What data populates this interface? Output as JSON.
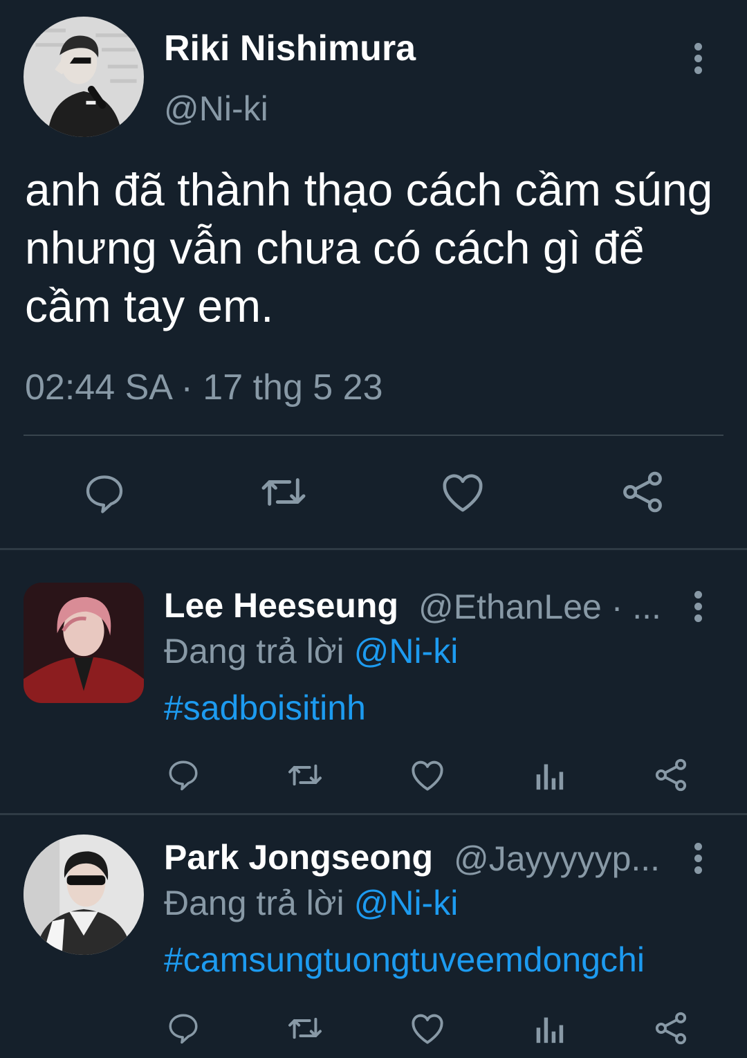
{
  "main_tweet": {
    "author_name": "Riki Nishimura",
    "author_handle": "@Ni-ki",
    "text": "anh đã thành thạo cách cầm súng nhưng vẫn chưa có cách gì để cầm tay em.",
    "timestamp": "02:44 SA · 17 thg 5 23",
    "avatar_icon": "person-avatar",
    "actions": [
      "reply-icon",
      "retweet-icon",
      "like-icon",
      "share-icon"
    ]
  },
  "replies": [
    {
      "author_name": "Lee Heeseung",
      "author_handle": "@EthanLee · ...",
      "replying_label": "Đang trả lời",
      "replying_to": "@Ni-ki",
      "hashtag": "#sadboisitinh"
    },
    {
      "author_name": "Park Jongseong",
      "author_handle": "@Jayyyyyp...",
      "replying_label": "Đang trả lời",
      "replying_to": "@Ni-ki",
      "hashtag": "#camsungtuongtuveemdongchi"
    }
  ],
  "colors": {
    "background": "#15202b",
    "accent": "#1d9bf0",
    "muted": "#8899a6",
    "divider": "#38444d"
  }
}
